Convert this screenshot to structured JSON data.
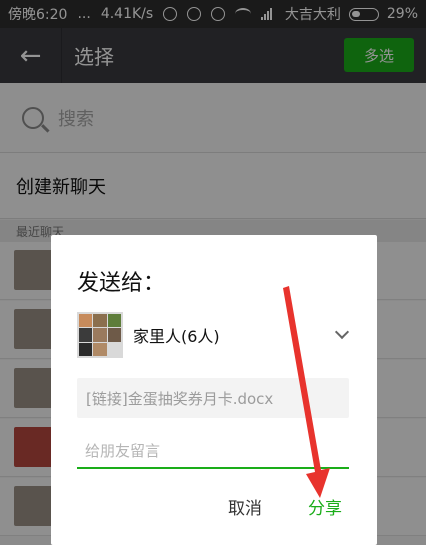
{
  "status_bar": {
    "carrier": "傍晚6:20",
    "dots": "...",
    "speed": "4.41K/s",
    "operator": "大吉大利",
    "battery": "29%"
  },
  "app_bar": {
    "title": "选择",
    "multi_select": "多选"
  },
  "search": {
    "placeholder": "搜索"
  },
  "list": {
    "new_chat": "创建新聊天",
    "section_label": "最近聊天"
  },
  "dialog": {
    "title": "发送给：",
    "target_name": "家里人(6人)",
    "file_name": "[链接]金蛋抽奖券月卡.docx",
    "message_placeholder": "给朋友留言",
    "cancel": "取消",
    "share": "分享"
  },
  "colors": {
    "accent": "#1aad19",
    "appbar": "#393a3f",
    "arrow": "#e8332d"
  }
}
